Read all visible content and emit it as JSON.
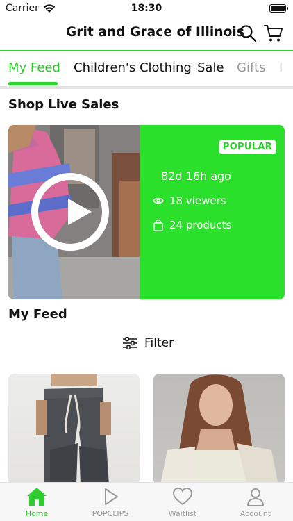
{
  "status_bar": {
    "carrier": "Carrier",
    "time": "18:30"
  },
  "header": {
    "title": "Grit and Grace of Illinois"
  },
  "tabs": [
    {
      "label": "My Feed"
    },
    {
      "label": "Children's Clothing"
    },
    {
      "label": "Sale"
    },
    {
      "label": "Gifts"
    }
  ],
  "live_section": {
    "title": "Shop Live Sales",
    "card": {
      "badge": "POPULAR",
      "time_ago": "82d 16h ago",
      "viewers": "18 viewers",
      "products": "24 products"
    }
  },
  "feed_section": {
    "title": "My Feed",
    "filter_label": "Filter"
  },
  "bottom_nav": [
    {
      "label": "Home"
    },
    {
      "label": "POPCLIPS"
    },
    {
      "label": "Waitlist"
    },
    {
      "label": "Account"
    }
  ],
  "colors": {
    "accent": "#2bdb2b",
    "card_bg": "#2be02b"
  }
}
